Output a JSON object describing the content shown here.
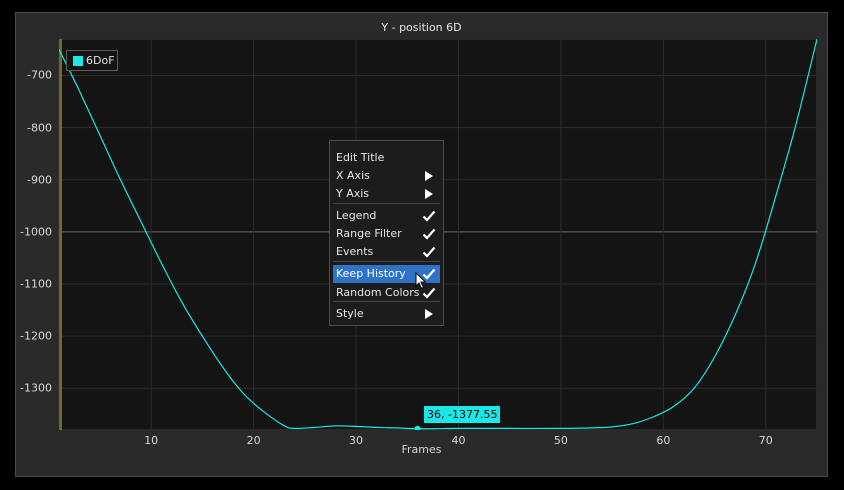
{
  "window": {
    "title": "Y - position 6D"
  },
  "legend": {
    "label": "6DoF",
    "color": "#19e8e8"
  },
  "axes": {
    "x_title": "Frames",
    "x_ticks": [
      "10",
      "20",
      "30",
      "40",
      "50",
      "60",
      "70"
    ],
    "y_ticks": [
      "-700",
      "-800",
      "-900",
      "-1000",
      "-1100",
      "-1200",
      "-1300"
    ]
  },
  "tooltip": {
    "text": "36, -1377.55"
  },
  "context_menu": {
    "items": [
      {
        "label": "Edit Title",
        "mark": ""
      },
      {
        "label": "X Axis",
        "mark": "submenu-arrow-icon"
      },
      {
        "label": "Y Axis",
        "mark": "submenu-arrow-icon"
      },
      {
        "label": "Legend",
        "mark": "checkmark-icon"
      },
      {
        "label": "Range Filter",
        "mark": "checkmark-icon"
      },
      {
        "label": "Events",
        "mark": "checkmark-icon"
      },
      {
        "label": "Keep History",
        "mark": "checkmark-icon",
        "highlighted": true
      },
      {
        "label": "Random Colors",
        "mark": "checkmark-icon"
      },
      {
        "label": "Style",
        "mark": "submenu-arrow-icon"
      }
    ]
  },
  "chart_data": {
    "type": "line",
    "title": "Y - position 6D",
    "xlabel": "Frames",
    "ylabel": "",
    "xlim": [
      1,
      75
    ],
    "ylim": [
      -1380,
      -630
    ],
    "grid": true,
    "legend_position": "top-left",
    "series": [
      {
        "name": "6DoF",
        "color": "#19e8e8",
        "x": [
          1,
          3,
          5,
          7,
          9,
          11,
          13,
          15,
          17,
          19,
          21,
          23,
          24,
          26,
          28,
          30,
          32,
          34,
          36,
          40,
          45,
          50,
          53,
          55,
          57,
          59,
          61,
          63,
          65,
          67,
          69,
          71,
          73,
          75
        ],
        "y": [
          -650,
          -730,
          -815,
          -900,
          -980,
          -1060,
          -1135,
          -1200,
          -1260,
          -1310,
          -1345,
          -1372,
          -1377,
          -1375,
          -1372,
          -1373,
          -1375,
          -1376,
          -1377.55,
          -1377,
          -1377,
          -1377,
          -1376,
          -1374,
          -1368,
          -1355,
          -1335,
          -1300,
          -1240,
          -1160,
          -1060,
          -930,
          -790,
          -630
        ]
      }
    ]
  }
}
